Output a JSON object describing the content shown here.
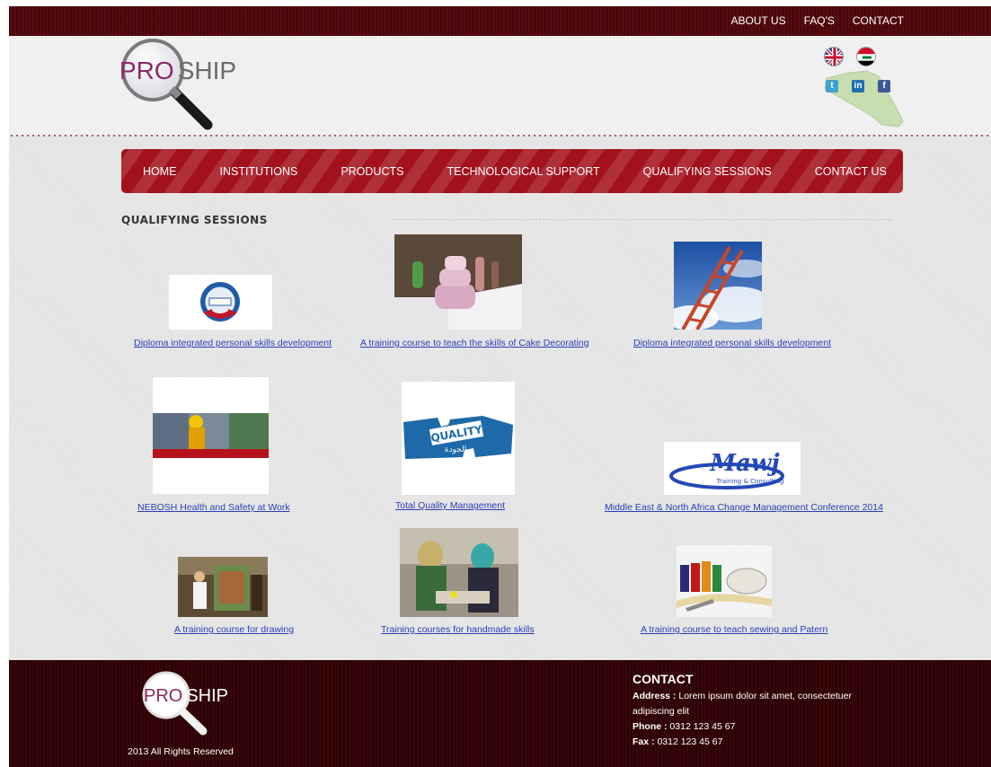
{
  "top_nav": [
    "ABOUT US",
    "FAQ'S",
    "CONTACT"
  ],
  "logo": {
    "pro": "PRO",
    "ship": "SHIP"
  },
  "main_nav": [
    "HOME",
    "INSTITUTIONS",
    "PRODUCTS",
    "TECHNOLOGICAL SUPPORT",
    "QUALIFYING SESSIONS",
    "CONTACT US"
  ],
  "section_title": "QUALIFYING SESSIONS",
  "sessions": [
    {
      "caption": "Diploma integrated personal skills development",
      "image": "mem-seal-logo"
    },
    {
      "caption": "A training course to teach the skills of Cake Decorating",
      "image": "decorated-cakes-photo"
    },
    {
      "caption": "Diploma integrated personal skills development",
      "image": "ladder-to-sky-photo"
    },
    {
      "caption": "NEBOSH Health and Safety at Work",
      "image": "nebosh-banner-photo"
    },
    {
      "caption": "Total Quality Management",
      "image": "quality-puzzle-image"
    },
    {
      "caption": "Middle East & North Africa Change Management Conference 2014",
      "image": "mawj-logo"
    },
    {
      "caption": "A training course for drawing",
      "image": "drawing-class-photo"
    },
    {
      "caption": "Training courses for handmade skills",
      "image": "handmade-workshop-photo"
    },
    {
      "caption": "A training course to teach sewing and Patern",
      "image": "sewing-threads-photo"
    }
  ],
  "mawj_text": {
    "name": "Mawj",
    "tagline": "Training & Consulting"
  },
  "quality_text": {
    "en": "QUALITY",
    "ar": "الجودة"
  },
  "footer": {
    "logo_pro": "PRO",
    "logo_ship": "SHIP",
    "copyright": "2013 All Rights Reserved",
    "contact_title": "CONTACT",
    "address_label": "Address :",
    "address": "Lorem ipsum dolor sit amet, consectetuer adipiscing elit",
    "phone_label": "Phone :",
    "phone": "0312 123 45 67",
    "fax_label": "Fax :",
    "fax": "0312 123 45 67"
  },
  "colors": {
    "topbar": "#5a0a10",
    "nav": "#a2111c",
    "footer": "#3a0508",
    "link": "#2a3fb8"
  }
}
